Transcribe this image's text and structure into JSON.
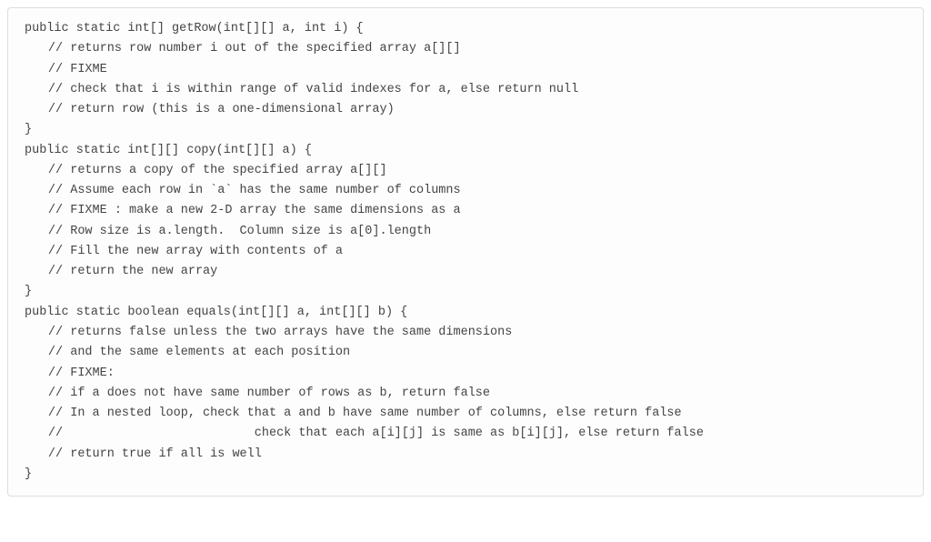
{
  "code": {
    "lines": [
      {
        "indent": 0,
        "text": "public static int[] getRow(int[][] a, int i) {"
      },
      {
        "indent": 1,
        "text": "// returns row number i out of the specified array a[][]"
      },
      {
        "indent": 1,
        "text": "// FIXME"
      },
      {
        "indent": 1,
        "text": "// check that i is within range of valid indexes for a, else return null"
      },
      {
        "indent": 1,
        "text": "// return row (this is a one-dimensional array)"
      },
      {
        "indent": 0,
        "text": "}"
      },
      {
        "indent": 0,
        "text": ""
      },
      {
        "indent": 0,
        "text": "public static int[][] copy(int[][] a) {"
      },
      {
        "indent": 1,
        "text": "// returns a copy of the specified array a[][]"
      },
      {
        "indent": 1,
        "text": "// Assume each row in `a` has the same number of columns"
      },
      {
        "indent": 1,
        "text": "// FIXME : make a new 2-D array the same dimensions as a"
      },
      {
        "indent": 1,
        "text": "// Row size is a.length.  Column size is a[0].length"
      },
      {
        "indent": 1,
        "text": "// Fill the new array with contents of a"
      },
      {
        "indent": 1,
        "text": "// return the new array"
      },
      {
        "indent": 0,
        "text": "}"
      },
      {
        "indent": 0,
        "text": ""
      },
      {
        "indent": 0,
        "text": "public static boolean equals(int[][] a, int[][] b) {"
      },
      {
        "indent": 1,
        "text": "// returns false unless the two arrays have the same dimensions"
      },
      {
        "indent": 1,
        "text": "// and the same elements at each position"
      },
      {
        "indent": 1,
        "text": "// FIXME:"
      },
      {
        "indent": 1,
        "text": "// if a does not have same number of rows as b, return false"
      },
      {
        "indent": 1,
        "text": "// In a nested loop, check that a and b have same number of columns, else return false"
      },
      {
        "indent": 1,
        "text": "//                          check that each a[i][j] is same as b[i][j], else return false"
      },
      {
        "indent": 1,
        "text": "// return true if all is well"
      },
      {
        "indent": 0,
        "text": "}"
      }
    ]
  }
}
